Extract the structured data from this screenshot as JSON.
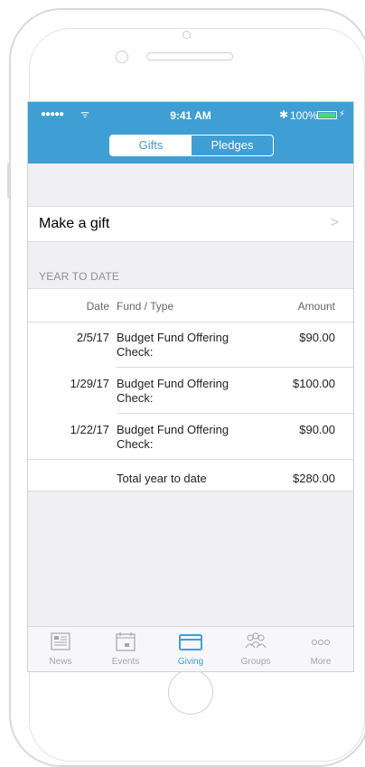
{
  "status_bar": {
    "signal": "●●●●●",
    "wifi": "ᯤ",
    "time": "9:41 AM",
    "bluetooth": "✱",
    "battery": "100%",
    "charging": "⚡"
  },
  "segmented": {
    "items": [
      {
        "label": "Gifts",
        "active": true
      },
      {
        "label": "Pledges",
        "active": false
      }
    ]
  },
  "make_gift": {
    "label": "Make a gift",
    "chevron": ">"
  },
  "section": {
    "title": "YEAR TO DATE"
  },
  "table": {
    "headers": {
      "date": "Date",
      "fund": "Fund / Type",
      "amount": "Amount"
    },
    "rows": [
      {
        "date": "2/5/17",
        "fund": "Budget Fund Offering",
        "type": "Check:",
        "amount": "$90.00"
      },
      {
        "date": "1/29/17",
        "fund": "Budget Fund Offering",
        "type": "Check:",
        "amount": "$100.00"
      },
      {
        "date": "1/22/17",
        "fund": "Budget Fund Offering",
        "type": "Check:",
        "amount": "$90.00"
      }
    ],
    "total": {
      "label": "Total year to date",
      "amount": "$280.00"
    }
  },
  "tabbar": {
    "items": [
      {
        "label": "News",
        "icon": "news-icon",
        "active": false
      },
      {
        "label": "Events",
        "icon": "calendar-icon",
        "active": false
      },
      {
        "label": "Giving",
        "icon": "credit-card-icon",
        "active": true
      },
      {
        "label": "Groups",
        "icon": "people-icon",
        "active": false
      },
      {
        "label": "More",
        "icon": "more-icon",
        "active": false
      }
    ]
  },
  "colors": {
    "accent": "#3f9fd4",
    "background": "#efeff4",
    "inactive_tab": "#a4a4aa"
  }
}
